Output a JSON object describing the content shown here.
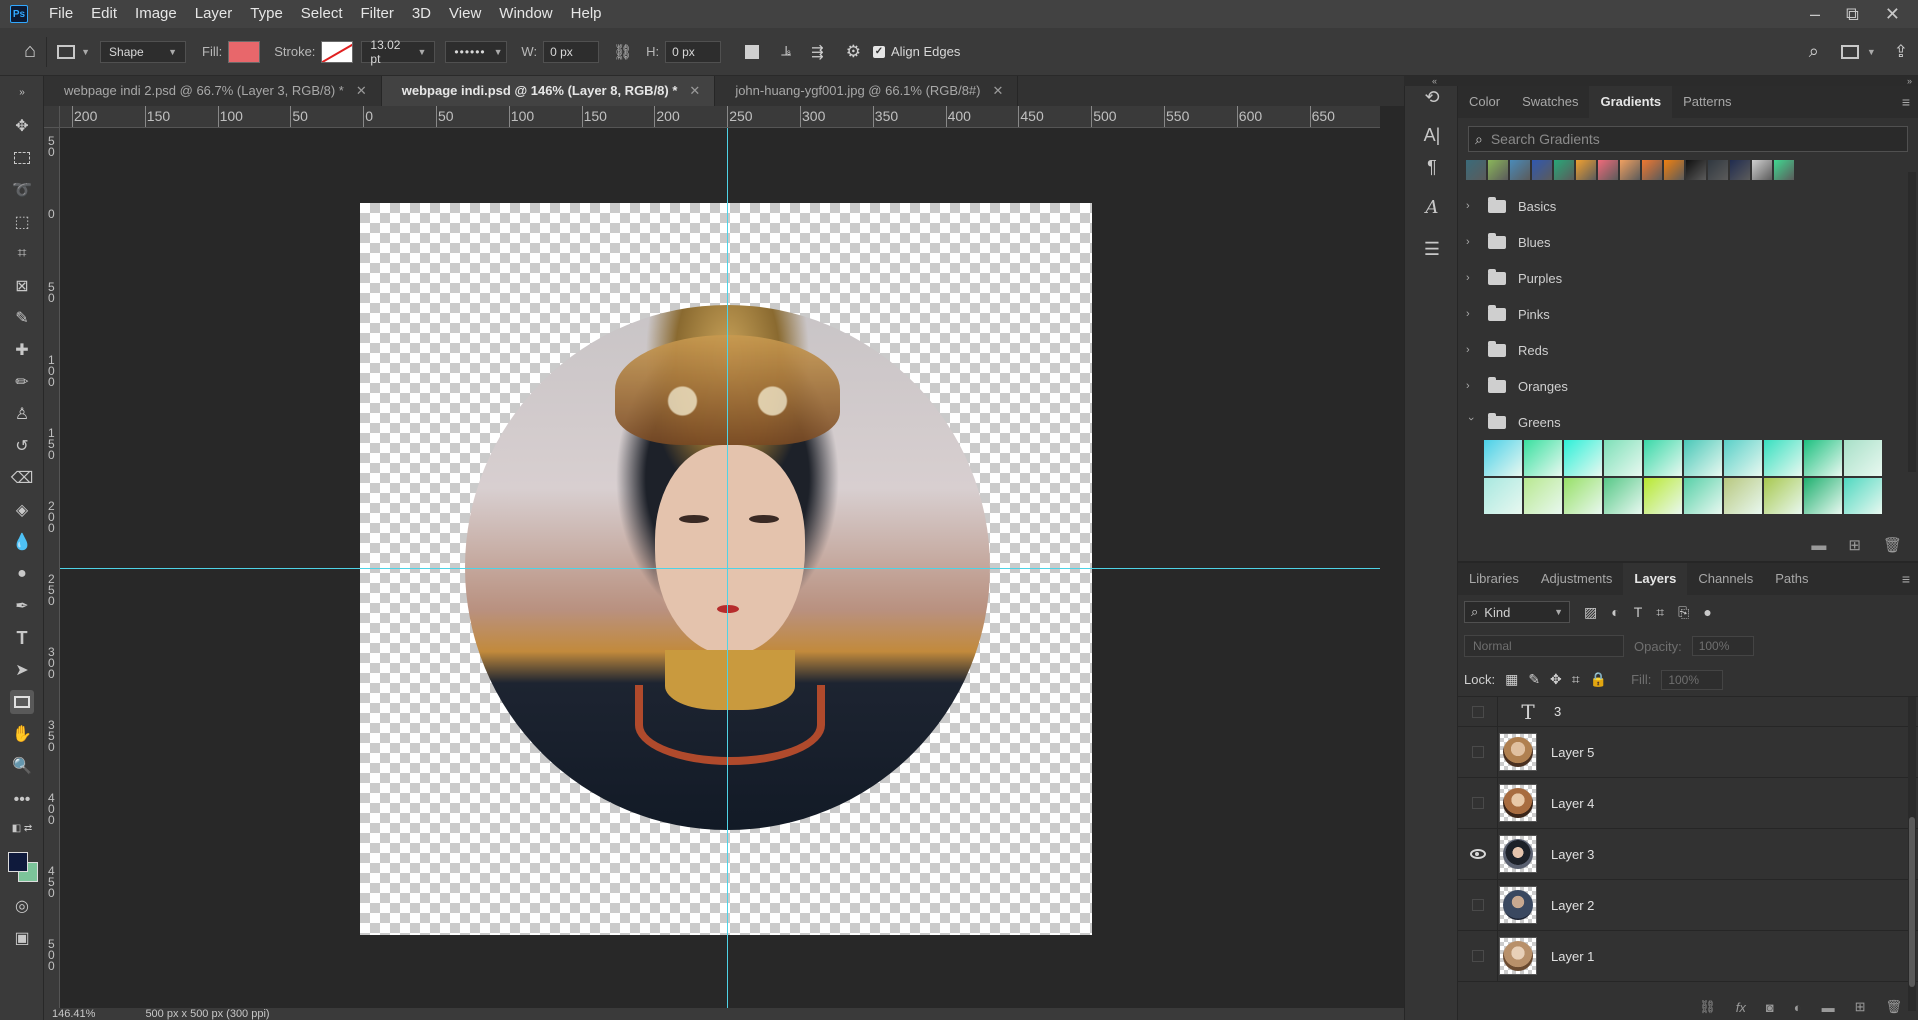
{
  "app": {
    "logo": "Ps",
    "menu": [
      "File",
      "Edit",
      "Image",
      "Layer",
      "Type",
      "Select",
      "Filter",
      "3D",
      "View",
      "Window",
      "Help"
    ],
    "window_controls": [
      "–",
      "⧉",
      "✕"
    ]
  },
  "options_bar": {
    "tool_mode": "Shape",
    "fill_label": "Fill:",
    "fill_color": "#e8676b",
    "stroke_label": "Stroke:",
    "stroke_width": "13.02 pt",
    "w_label": "W:",
    "w_value": "0 px",
    "h_label": "H:",
    "h_value": "0 px",
    "align_edges_label": "Align Edges"
  },
  "tabs": [
    {
      "label": "webpage indi 2.psd @ 66.7% (Layer 3, RGB/8) *",
      "active": false
    },
    {
      "label": "webpage indi.psd @ 146% (Layer 8, RGB/8) *",
      "active": true
    },
    {
      "label": "john-huang-ygf001.jpg @ 66.1% (RGB/8#)",
      "active": false
    }
  ],
  "rulers": {
    "horizontal": [
      "200",
      "150",
      "100",
      "50",
      "0",
      "50",
      "100",
      "150",
      "200",
      "250",
      "300",
      "350",
      "400",
      "450",
      "500",
      "550",
      "600",
      "650"
    ],
    "vertical": [
      "50",
      "0",
      "50",
      "100",
      "150",
      "200",
      "250",
      "300",
      "350",
      "400",
      "450",
      "500"
    ]
  },
  "status_bar": {
    "zoom": "146.41%",
    "doc_size": "500 px x 500 px (300 ppi)"
  },
  "gradients_panel": {
    "tabs": [
      {
        "label": "Color",
        "active": false
      },
      {
        "label": "Swatches",
        "active": false
      },
      {
        "label": "Gradients",
        "active": true
      },
      {
        "label": "Patterns",
        "active": false
      }
    ],
    "search_placeholder": "Search Gradients",
    "presets": [
      "#3a6b7a",
      "#8ab65a",
      "#4a8ab8",
      "#3058b0",
      "#28a878",
      "#f0a030",
      "#f06a7a",
      "#f0a060",
      "#f07830",
      "#f08010",
      "#101010",
      "#303840",
      "#202c50",
      "#d0d0d0",
      "#40d890"
    ],
    "folders": [
      {
        "name": "Basics",
        "open": false
      },
      {
        "name": "Blues",
        "open": false
      },
      {
        "name": "Purples",
        "open": false
      },
      {
        "name": "Pinks",
        "open": false
      },
      {
        "name": "Reds",
        "open": false
      },
      {
        "name": "Oranges",
        "open": false
      },
      {
        "name": "Greens",
        "open": true
      }
    ],
    "greens": [
      "#4ad0e8",
      "#3ae0a0",
      "#2ef0d8",
      "#7ee0b8",
      "#3ad8a8",
      "#4ac8b8",
      "#5ad0c8",
      "#38e0c0",
      "#1ec080",
      "#a8e0c8",
      "#a8e8e0",
      "#b8e890",
      "#98e068",
      "#58c888",
      "#b8e830",
      "#58d0a8",
      "#b8c880",
      "#a8c850",
      "#20b070",
      "#50d8c0"
    ]
  },
  "layers_panel": {
    "tabs": [
      {
        "label": "Libraries",
        "active": false
      },
      {
        "label": "Adjustments",
        "active": false
      },
      {
        "label": "Layers",
        "active": true
      },
      {
        "label": "Channels",
        "active": false
      },
      {
        "label": "Paths",
        "active": false
      }
    ],
    "filter_kind": "Kind",
    "blend_mode": "Normal",
    "opacity_label": "Opacity:",
    "opacity_value": "100%",
    "lock_label": "Lock:",
    "fill_label": "Fill:",
    "fill_value": "100%",
    "layers": [
      {
        "name": "3",
        "kind": "type",
        "visible": false
      },
      {
        "name": "Layer 5",
        "kind": "image",
        "visible": false,
        "thumb": "#b08050"
      },
      {
        "name": "Layer 4",
        "kind": "image",
        "visible": false,
        "thumb": "#a86c40"
      },
      {
        "name": "Layer 3",
        "kind": "image",
        "visible": true,
        "thumb": "#5a6070"
      },
      {
        "name": "Layer 2",
        "kind": "image",
        "visible": false,
        "thumb": "#3a4860"
      },
      {
        "name": "Layer 1",
        "kind": "image",
        "visible": false,
        "thumb": "#b8906a"
      }
    ]
  }
}
